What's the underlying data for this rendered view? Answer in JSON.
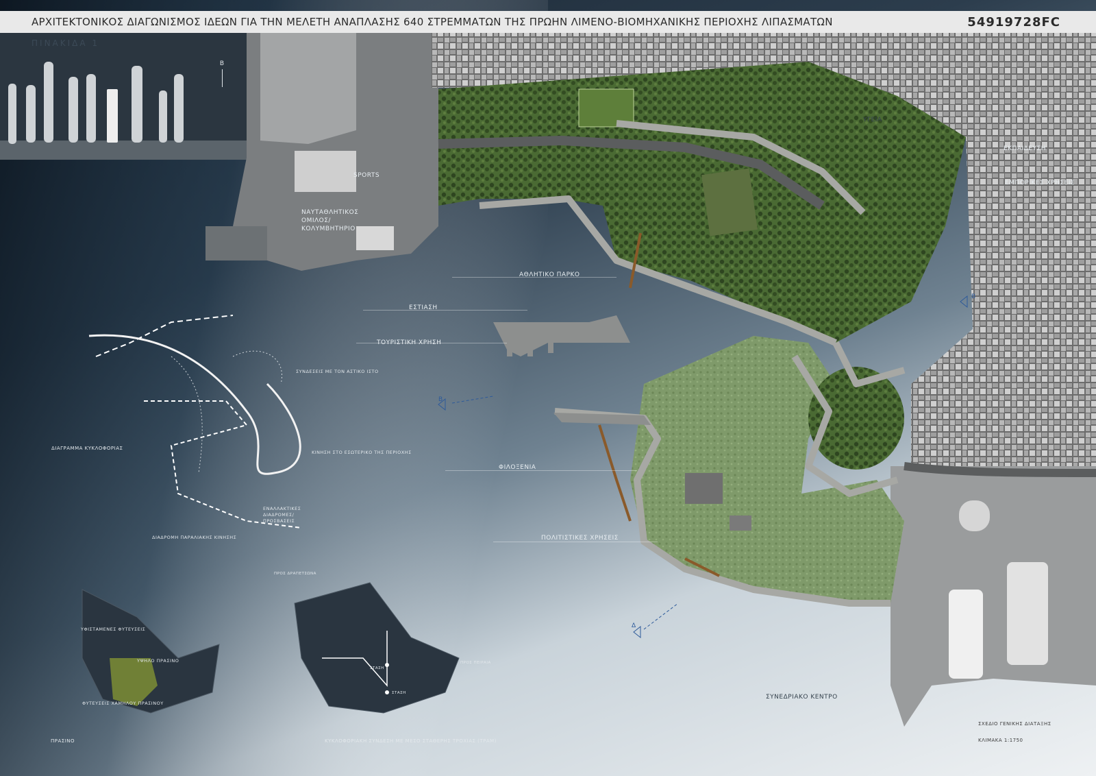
{
  "header": {
    "title": "ΑΡΧΙΤΕΚΤΟΝΙΚΟΣ ΔΙΑΓΩΝΙΣΜΟΣ  ΙΔΕΩΝ ΓΙΑ ΤΗΝ ΜΕΛΕΤΗ ΑΝΑΠΛΑΣΗΣ 640 ΣΤΡΕΜΜΑΤΩΝ ΤΗΣ ΠΡΩΗΝ ΛΙΜΕΝΟ-ΒΙΟΜΗΧΑΝΙΚΗΣ ΠΕΡΙΟΧΗΣ ΛΙΠΑΣΜΑΤΩΝ",
    "code": "54919728FC"
  },
  "sheet_label": "ΠΙΝΑΚΙΔΑ 1",
  "north_arrow": "Β",
  "zones": {
    "sports": "SPORTS",
    "nautical": "ΝΑΥΤΑΘΛΗΤΙΚΟΣ ΟΜΙΛΟΣ/ ΚΟΛΥΜΒΗΤΗΡΙΟ",
    "health": "ΥΓΕΙΑ",
    "education": "ΕΚΠΑΙΔΕΥΣΗ",
    "commercial": "ΕΜΠΟΡΙΚΕΣ ΧΡΗΣΕΙΣ",
    "sports_park": "ΑΘΛΗΤΙΚΟ ΠΑΡΚΟ",
    "dining": "ΕΣΤΙΑΣΗ",
    "tourism": "ΤΟΥΡΙΣΤΙΚΗ ΧΡΗΣΗ",
    "hospitality": "ΦΙΛΟΞΕΝΙΑ",
    "cultural": "ΠΟΛΙΤΙΣΤΙΚΕΣ ΧΡΗΣΕΙΣ",
    "conference": "ΣΥΝΕΔΡΙΑΚΟ ΚΕΝΤΡΟ"
  },
  "diagrams": {
    "traffic_title": "ΔΙΑΓΡΑΜΜΑ ΚΥΚΛΟΦΟΡΙΑΣ",
    "connections": "ΣΥΝΔΕΣΕΙΣ ΜΕ ΤΟΝ ΑΣΤΙΚΟ ΙΣΤΟ",
    "internal": "ΚΙΝΗΣΗ ΣΤΟ ΕΣΩΤΕΡΙΚΟ ΤΗΣ ΠΕΡΙΟΧΗΣ",
    "alternative": "ΕΝΑΛΛΑΚΤΙΚΕΣ ΔΙΑΔΡΟΜΕΣ/ ΠΡΟΣΒΑΣΕΙΣ",
    "coastal": "ΔΙΑΔΡΟΜΗ ΠΑΡΑΛΙΑΚΗΣ ΚΙΝΗΣΗΣ",
    "existing_plantings": "ΥΦΙΣΤΑΜΕΝΕΣ ΦΥΤΕΥΣΕΙΣ",
    "high_green": "ΥΨΗΛΟ ΠΡΑΣΙΝΟ",
    "low_green": "ΦΥΤΕΥΣΕΙΣ ΧΑΜΗΛΟΥ ΠΡΑΣΙΝΟΥ",
    "green_title": "ΠΡΑΣΙΝΟ",
    "tram_title": "ΚΥΚΛΟΦΟΡΙΑΚΗ ΣΥΝΔΕΣΗ ΜΕ ΜΕΣΟ ΣΤΑΘΕΡΗΣ ΤΡΟΧΙΑΣ (ΤΡΑΜ)",
    "tram_a": "ΠΡΟΣ ΔΡΑΠΕΤΣΩΝΑ",
    "tram_b": "ΠΡΟΣ ΠΕΙΡΑΙΑ",
    "tram_stop_1": "ΣΤΑΣΗ",
    "tram_stop_2": "ΣΤΑΣΗ"
  },
  "plan": {
    "title": "ΣΧΕΔΙΟ ΓΕΝΙΚΗΣ ΔΙΑΤΑΞΗΣ",
    "scale": "ΚΛΙΜΑΚΑ 1:1750"
  },
  "section_markers": {
    "a": "Β",
    "b": "Β",
    "c": "Δ"
  },
  "colors": {
    "sea_dark": "#1a2633",
    "sea_light": "#eef1f3",
    "park_green": "#3f5a2a",
    "promenade": "#9a9a96",
    "city": "#8e8e8e",
    "accent_rust": "#8a5a2a"
  }
}
